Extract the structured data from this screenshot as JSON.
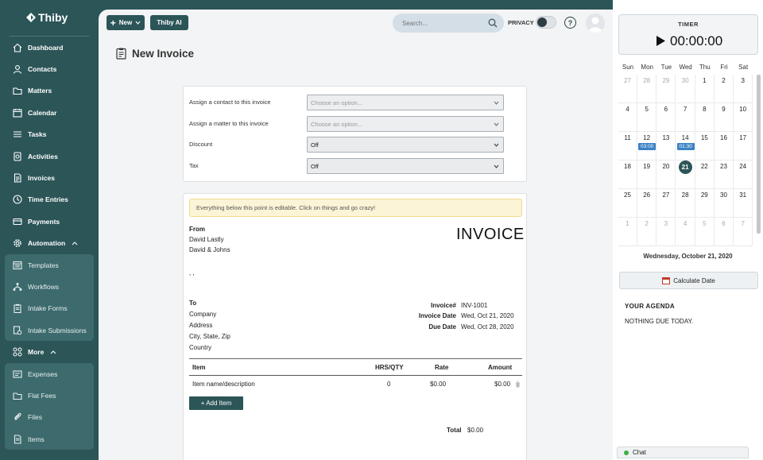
{
  "app": {
    "logo_text": "Thiby"
  },
  "sidebar": {
    "items": [
      {
        "label": "Dashboard",
        "icon": "home-icon"
      },
      {
        "label": "Contacts",
        "icon": "person-icon"
      },
      {
        "label": "Matters",
        "icon": "folder-icon"
      },
      {
        "label": "Calendar",
        "icon": "calendar-icon"
      },
      {
        "label": "Tasks",
        "icon": "list-icon"
      },
      {
        "label": "Activities",
        "icon": "activity-icon"
      },
      {
        "label": "Invoices",
        "icon": "invoice-icon"
      },
      {
        "label": "Time Entries",
        "icon": "clock-icon"
      },
      {
        "label": "Payments",
        "icon": "card-icon"
      }
    ],
    "automation": {
      "label": "Automation",
      "icon": "gear-icon",
      "items": [
        {
          "label": "Templates",
          "icon": "template-icon"
        },
        {
          "label": "Workflows",
          "icon": "workflow-icon"
        },
        {
          "label": "Intake Forms",
          "icon": "clipboard-icon"
        },
        {
          "label": "Intake Submissions",
          "icon": "submission-icon"
        }
      ]
    },
    "more": {
      "label": "More",
      "icon": "grid-icon",
      "items": [
        {
          "label": "Expenses",
          "icon": "expense-icon"
        },
        {
          "label": "Flat Fees",
          "icon": "folder-icon"
        },
        {
          "label": "Files",
          "icon": "paperclip-icon"
        },
        {
          "label": "Items",
          "icon": "document-icon"
        }
      ]
    }
  },
  "topbar": {
    "new_label": "New",
    "ai_label": "Thiby AI",
    "search_placeholder": "Search...",
    "privacy_label": "PRIVACY",
    "help_label": "?"
  },
  "page": {
    "title": "New Invoice"
  },
  "form": {
    "contact": {
      "label": "Assign a contact to this invoice",
      "value": "Choose an option..."
    },
    "matter": {
      "label": "Assign a matter to this invoice",
      "value": "Choose an option..."
    },
    "discount": {
      "label": "Discount",
      "value": "Off"
    },
    "tax": {
      "label": "Tax",
      "value": "Off"
    }
  },
  "invoice": {
    "notice": "Everything below this point is editable. Click on things and go crazy!",
    "heading": "INVOICE",
    "from_label": "From",
    "from_lines": [
      "David Lastly",
      "David & Johns"
    ],
    "from_address": ", ,",
    "to_label": "To",
    "to_lines": [
      "Company",
      "Address",
      "City, State, Zip",
      "Country"
    ],
    "meta": [
      {
        "label": "Invoice#",
        "value": "INV-1001"
      },
      {
        "label": "Invoice Date",
        "value": "Wed, Oct 21, 2020"
      },
      {
        "label": "Due Date",
        "value": "Wed, Oct 28, 2020"
      }
    ],
    "columns": {
      "item": "Item",
      "hrs": "HRS/QTY",
      "rate": "Rate",
      "amount": "Amount"
    },
    "rows": [
      {
        "item": "Item name/description",
        "hrs": "0",
        "rate": "$0.00",
        "amount": "$0.00"
      }
    ],
    "add_item_label": "+ Add Item",
    "total_label": "Total",
    "total_value": "$0.00"
  },
  "timer": {
    "title": "TIMER",
    "time": "00:00:00"
  },
  "calendar": {
    "days": [
      "Sun",
      "Mon",
      "Tue",
      "Wed",
      "Thu",
      "Fri",
      "Sat"
    ],
    "weeks": [
      [
        "27",
        "28",
        "29",
        "30",
        "1",
        "2",
        "3"
      ],
      [
        "4",
        "5",
        "6",
        "7",
        "8",
        "9",
        "10"
      ],
      [
        "11",
        "12",
        "13",
        "14",
        "15",
        "16",
        "17"
      ],
      [
        "18",
        "19",
        "20",
        "21",
        "22",
        "23",
        "24"
      ],
      [
        "25",
        "26",
        "27",
        "28",
        "29",
        "30",
        "31"
      ],
      [
        "1",
        "2",
        "3",
        "4",
        "5",
        "6",
        "7"
      ]
    ],
    "events": [
      {
        "label": "03:00"
      },
      {
        "label": "01:30"
      }
    ],
    "selected_date": "Wednesday, October 21, 2020",
    "accent": "#2c5558",
    "event_color": "#3b82c4"
  },
  "agenda": {
    "calc_label": "Calculate Date",
    "title": "YOUR AGENDA",
    "empty": "NOTHING DUE TODAY."
  },
  "chat": {
    "label": "Chat"
  }
}
